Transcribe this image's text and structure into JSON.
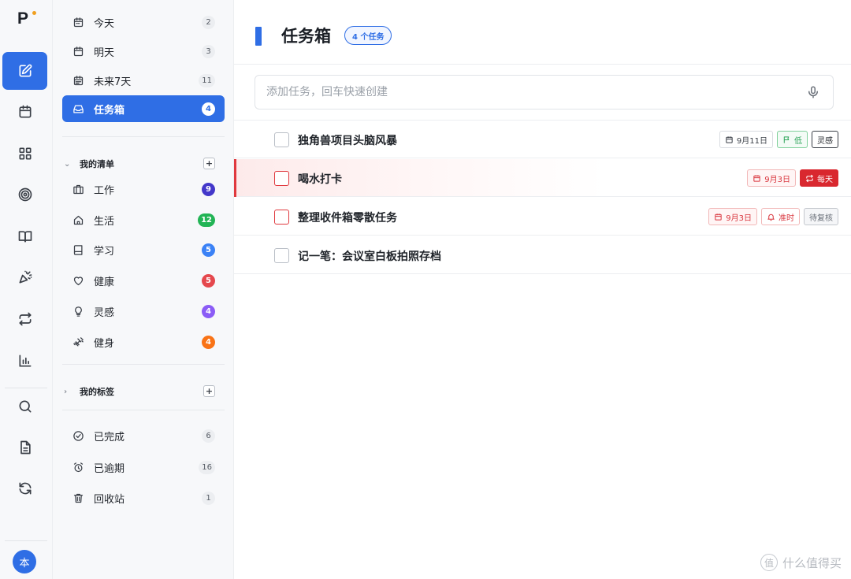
{
  "app": {
    "logo_text": "P",
    "avatar_text": "本"
  },
  "rail": {
    "items": [
      {
        "name": "edit-icon",
        "active": true
      },
      {
        "name": "calendar-icon",
        "active": false
      },
      {
        "name": "grid-icon",
        "active": false
      },
      {
        "name": "target-icon",
        "active": false
      },
      {
        "name": "book-icon",
        "active": false
      },
      {
        "name": "party-icon",
        "active": false
      },
      {
        "name": "repeat-icon",
        "active": false
      },
      {
        "name": "bar-chart-icon",
        "active": false
      },
      {
        "name": "search-icon",
        "active": false
      },
      {
        "name": "document-icon",
        "active": false
      },
      {
        "name": "sync-icon",
        "active": false
      }
    ]
  },
  "sidebar": {
    "smart": [
      {
        "label": "今天",
        "count": "2",
        "icon": "calendar-icon"
      },
      {
        "label": "明天",
        "count": "3",
        "icon": "calendar-icon"
      },
      {
        "label": "未来7天",
        "count": "11",
        "icon": "calendar-week-icon"
      },
      {
        "label": "任务箱",
        "count": "4",
        "icon": "inbox-icon",
        "active": true
      }
    ],
    "lists_header": "我的清单",
    "lists": [
      {
        "label": "工作",
        "count": "9",
        "color": "#4338ca",
        "icon": "briefcase-icon"
      },
      {
        "label": "生活",
        "count": "12",
        "color": "#22b455",
        "icon": "home-icon"
      },
      {
        "label": "学习",
        "count": "5",
        "color": "#3b82f6",
        "icon": "notebook-icon"
      },
      {
        "label": "健康",
        "count": "5",
        "color": "#e5484d",
        "icon": "heart-icon"
      },
      {
        "label": "灵感",
        "count": "4",
        "color": "#8b5cf6",
        "icon": "bulb-icon"
      },
      {
        "label": "健身",
        "count": "4",
        "color": "#f97316",
        "icon": "dumbbell-icon"
      }
    ],
    "tags_header": "我的标签",
    "system": [
      {
        "label": "已完成",
        "count": "6",
        "icon": "check-circle-icon"
      },
      {
        "label": "已逾期",
        "count": "16",
        "icon": "alarm-icon"
      },
      {
        "label": "回收站",
        "count": "1",
        "icon": "trash-icon"
      }
    ]
  },
  "main": {
    "title": "任务箱",
    "count_label": "4 个任务",
    "input_placeholder": "添加任务，回车快速创建",
    "tasks": [
      {
        "title": "独角兽项目头脑风暴",
        "urgent": false,
        "tags": [
          {
            "kind": "date",
            "text": "9月11日"
          },
          {
            "kind": "low",
            "text": "低"
          },
          {
            "kind": "dark",
            "text": "灵感"
          }
        ]
      },
      {
        "title": "喝水打卡",
        "urgent": true,
        "tags": [
          {
            "kind": "date-red",
            "text": "9月3日"
          },
          {
            "kind": "repeat",
            "text": "每天"
          }
        ]
      },
      {
        "title": "整理收件箱零散任务",
        "urgent": true,
        "tags": [
          {
            "kind": "date-red",
            "text": "9月3日"
          },
          {
            "kind": "remind",
            "text": "准时"
          },
          {
            "kind": "pending",
            "text": "待复核"
          }
        ]
      },
      {
        "title": "记一笔：会议室白板拍照存档",
        "urgent": false,
        "tags": []
      }
    ]
  },
  "watermark": {
    "text": "什么值得买",
    "logo": "值"
  }
}
